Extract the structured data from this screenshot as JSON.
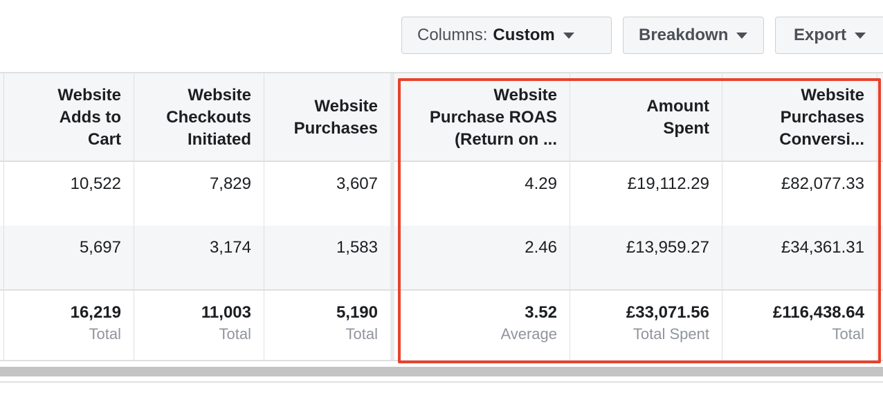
{
  "toolbar": {
    "columns_prefix": "Columns:",
    "columns_value": "Custom",
    "breakdown_label": "Breakdown",
    "export_label": "Export"
  },
  "table": {
    "headers": [
      [
        "Website",
        "Adds to",
        "Cart"
      ],
      [
        "Website",
        "Checkouts",
        "Initiated"
      ],
      [
        "Website",
        "Purchases"
      ],
      [
        "Website",
        "Purchase ROAS",
        "(Return on ..."
      ],
      [
        "Amount",
        "Spent"
      ],
      [
        "Website",
        "Purchases",
        "Conversi..."
      ]
    ],
    "rows": [
      [
        "10,522",
        "7,829",
        "3,607",
        "4.29",
        "£19,112.29",
        "£82,077.33"
      ],
      [
        "5,697",
        "3,174",
        "1,583",
        "2.46",
        "£13,959.27",
        "£34,361.31"
      ]
    ],
    "totals": [
      {
        "value": "16,219",
        "label": "Total"
      },
      {
        "value": "11,003",
        "label": "Total"
      },
      {
        "value": "5,190",
        "label": "Total"
      },
      {
        "value": "3.52",
        "label": "Average"
      },
      {
        "value": "£33,071.56",
        "label": "Total Spent"
      },
      {
        "value": "£116,438.64",
        "label": "Total"
      }
    ]
  },
  "colors": {
    "highlight": "#e8412c",
    "header_bg": "#f5f6f7",
    "border": "#dddfe2"
  }
}
